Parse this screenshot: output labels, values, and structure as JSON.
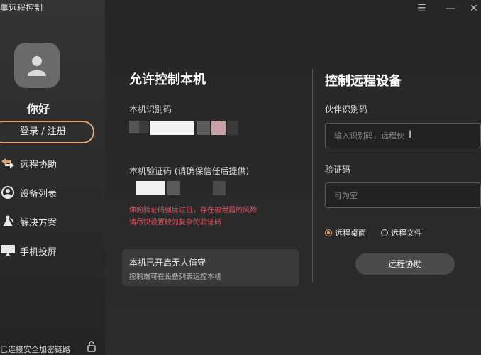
{
  "window": {
    "title": "薁远程控制",
    "menu_icon": "menu-icon",
    "minimize_icon": "minimize-icon",
    "close_icon": "close-icon"
  },
  "sidebar": {
    "greeting": "你好",
    "login_label": "登录 / 注册",
    "items": [
      {
        "label": "远程协助",
        "icon": "remote-assist-icon"
      },
      {
        "label": "设备列表",
        "icon": "device-list-icon"
      },
      {
        "label": "解决方案",
        "icon": "solution-icon"
      },
      {
        "label": "手机投屏",
        "icon": "screen-cast-icon"
      }
    ],
    "secure_text": "已连接安全加密链路"
  },
  "allow": {
    "title": "允许控制本机",
    "id_label": "本机识别码",
    "code_label": "本机验证码 (请确保信任后提供)",
    "warning_line1": "你的验证码强度过低，存在被泄露的风险",
    "warning_line2": "请尽快设置较为复杂的验证码",
    "unattended_title": "本机已开启无人值守",
    "unattended_sub": "控制端可在设备列表远控本机"
  },
  "control": {
    "title": "控制远程设备",
    "partner_label": "伙伴识别码",
    "partner_value": "输入识别码，远程伙",
    "code_label": "验证码",
    "code_placeholder": "可为空",
    "mode_desktop": "远程桌面",
    "mode_file": "远程文件",
    "assist_button": "远程协助"
  },
  "colors": {
    "accent": "#e3a670",
    "warning": "#e05a6a"
  }
}
